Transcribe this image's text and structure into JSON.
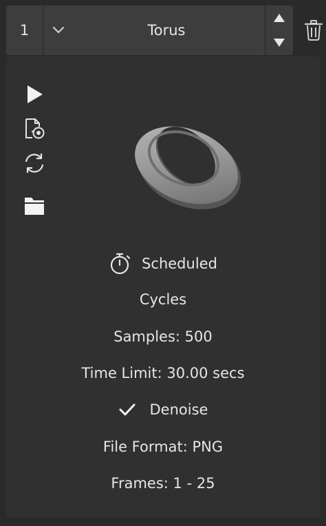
{
  "job": {
    "index": "1",
    "name": "Torus"
  },
  "icons": {
    "expand": "chevron-down-icon",
    "move_up": "triangle-up-icon",
    "move_down": "triangle-down-icon",
    "delete": "trash-icon",
    "render": "play-icon",
    "file_options": "file-render-icon",
    "sync": "refresh-icon",
    "open_folder": "folder-icon",
    "status": "stopwatch-icon",
    "denoise": "check-icon"
  },
  "details": {
    "status": "Scheduled",
    "engine": "Cycles",
    "samples": "Samples: 500",
    "time_limit": "Time Limit: 30.00 secs",
    "denoise": "Denoise",
    "file_format": "File Format: PNG",
    "frames": "Frames: 1 - 25"
  },
  "colors": {
    "background": "#2a2a2a",
    "header": "#3d3d3d",
    "panel": "#303030",
    "text": "#e6e6e6"
  }
}
